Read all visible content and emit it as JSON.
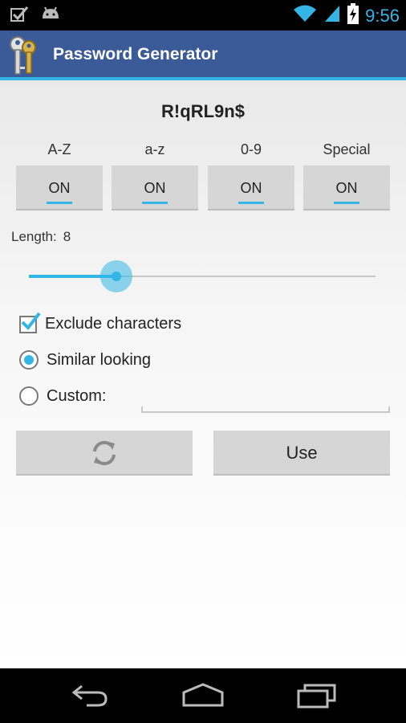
{
  "status_bar": {
    "time": "9:56",
    "left_icons": [
      "checkbox-notification-icon",
      "android-notification-icon"
    ],
    "right_icons": [
      "wifi-icon",
      "signal-icon",
      "battery-charging-icon"
    ]
  },
  "action_bar": {
    "title": "Password Generator",
    "icon": "keys-icon"
  },
  "password": "R!qRL9n$",
  "toggles": [
    {
      "label": "A-Z",
      "state": "ON"
    },
    {
      "label": "a-z",
      "state": "ON"
    },
    {
      "label": "0-9",
      "state": "ON"
    },
    {
      "label": "Special",
      "state": "ON"
    }
  ],
  "length": {
    "label": "Length:",
    "value": "8",
    "slider_fraction": 0.25
  },
  "exclude": {
    "label": "Exclude characters",
    "checked": true
  },
  "options": {
    "similar": {
      "label": "Similar looking",
      "selected": true
    },
    "custom": {
      "label": "Custom:",
      "selected": false,
      "value": ""
    }
  },
  "buttons": {
    "refresh_icon": "refresh-icon",
    "use": "Use"
  },
  "nav": [
    "back-icon",
    "home-icon",
    "recents-icon"
  ],
  "colors": {
    "accent": "#33b5e5",
    "action_bar": "#3a5a98",
    "button": "#d6d6d6"
  }
}
